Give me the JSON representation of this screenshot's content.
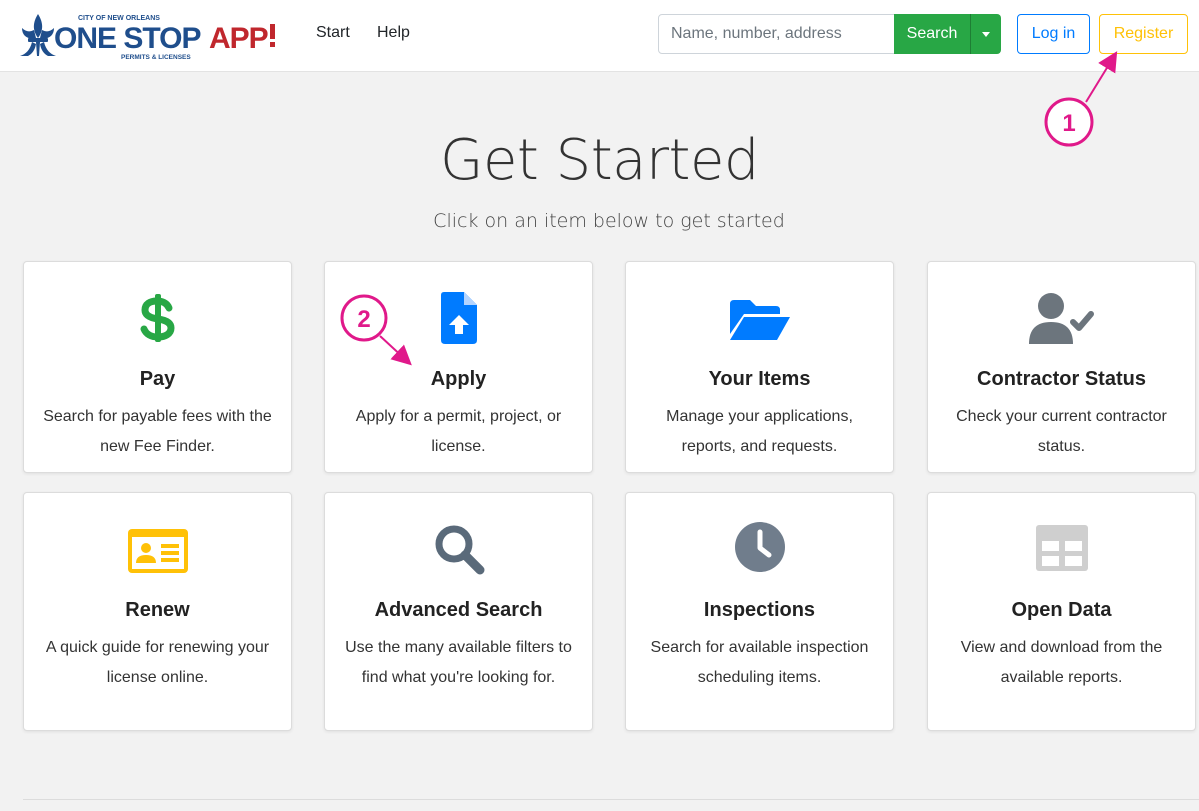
{
  "header": {
    "logo": {
      "top_text": "CITY OF NEW ORLEANS",
      "main_text": "ONE STOP",
      "app_text": "APP",
      "sub_text": "PERMITS & LICENSES"
    },
    "nav": [
      {
        "label": "Start"
      },
      {
        "label": "Help"
      }
    ],
    "search": {
      "placeholder": "Name, number, address",
      "button_label": "Search"
    },
    "login_label": "Log in",
    "register_label": "Register"
  },
  "main": {
    "title": "Get Started",
    "subtitle": "Click on an item below to get started",
    "cards": [
      {
        "title": "Pay",
        "description": "Search for payable fees with the new Fee Finder.",
        "icon": "dollar-icon",
        "color": "#28a745"
      },
      {
        "title": "Apply",
        "description": "Apply for a permit, project, or license.",
        "icon": "file-upload-icon",
        "color": "#007bff"
      },
      {
        "title": "Your Items",
        "description": "Manage your applications, reports, and requests.",
        "icon": "folder-open-icon",
        "color": "#007bff"
      },
      {
        "title": "Contractor Status",
        "description": "Check your current contractor status.",
        "icon": "user-check-icon",
        "color": "#6c757d"
      },
      {
        "title": "Renew",
        "description": "A quick guide for renewing your license online.",
        "icon": "id-card-icon",
        "color": "#ffc107"
      },
      {
        "title": "Advanced Search",
        "description": "Use the many available filters to find what you're looking for.",
        "icon": "search-icon",
        "color": "#5a6a7a"
      },
      {
        "title": "Inspections",
        "description": "Search for available inspection scheduling items.",
        "icon": "clock-icon",
        "color": "#707d8c"
      },
      {
        "title": "Open Data",
        "description": "View and download from the available reports.",
        "icon": "table-icon",
        "color": "#cfcfcf"
      }
    ]
  },
  "annotations": [
    {
      "label": "1",
      "color": "#e0198a"
    },
    {
      "label": "2",
      "color": "#e0198a"
    }
  ]
}
